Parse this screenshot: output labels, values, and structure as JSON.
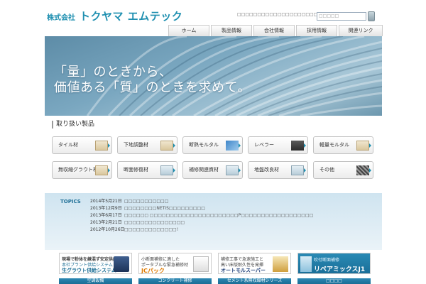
{
  "header": {
    "logo_prefix": "株式会社",
    "logo_name": "トクヤマ エムテック",
    "note": "□□□□□□□□□□□□□□□□□□□□□□□□□□□□□",
    "search_placeholder": "□□□□□"
  },
  "nav": {
    "items": [
      "ホーム",
      "製品情報",
      "会社情報",
      "採用情報",
      "関連リンク"
    ]
  },
  "hero": {
    "line1": "「量」のときから、",
    "line2": "価値ある「質」のときを求めて。"
  },
  "products": {
    "title": "取り扱い製品",
    "items": [
      {
        "label": "タイル材",
        "thumb": "bag"
      },
      {
        "label": "下地調整材",
        "thumb": "bag"
      },
      {
        "label": "断熱モルタル",
        "thumb": "sheet"
      },
      {
        "label": "レベラー",
        "thumb": "dark"
      },
      {
        "label": "軽量モルタル",
        "thumb": "bag"
      },
      {
        "label": "無収縮グラウト材",
        "thumb": "bag"
      },
      {
        "label": "断面修復材",
        "thumb": "bag2"
      },
      {
        "label": "補修関連資材",
        "thumb": "bag2"
      },
      {
        "label": "地盤改良材",
        "thumb": "bag2"
      },
      {
        "label": "その他",
        "thumb": "grid"
      }
    ]
  },
  "topics": {
    "label": "TOPICS",
    "items": [
      {
        "date": "2014年5月21日",
        "text": "□□□□□□□□□□□"
      },
      {
        "date": "2013年12月9日",
        "text": "□□□□□□□□NETIS□□□□□□□□□"
      },
      {
        "date": "2013年6月17日",
        "text": "□□□□□□ □□□□□□□□□□□□□□□□□□□□□□P□□□□□□□□□□□□□□□□□□"
      },
      {
        "date": "2013年2月21日",
        "text": "□□□□□□□□□□□□□□□"
      },
      {
        "date": "2012年10月26日",
        "text": "□□□□□□□□□□□□□!"
      }
    ]
  },
  "banners": [
    {
      "line_a": "現場で粉体を練混ず安定供給",
      "line_b": "本社プラント供給システム",
      "line_c": "生グラウト供給システム"
    },
    {
      "line_a": "小断面補修に適した",
      "line_b": "ポータブルな緊急補修材",
      "line_c": "JCパック"
    },
    {
      "line_a": "補修工事で急速施工と",
      "line_b": "高い床版耐久性を発揮",
      "line_c": "オートモルスーパー"
    },
    {
      "line_a": "吹付断面補修",
      "line_b": "",
      "line_c": "リペアミックスJ1"
    }
  ],
  "subbars": [
    "空調設備",
    "コンクリート補修",
    "セメント系無収縮材シリーズ",
    "□□□□"
  ]
}
